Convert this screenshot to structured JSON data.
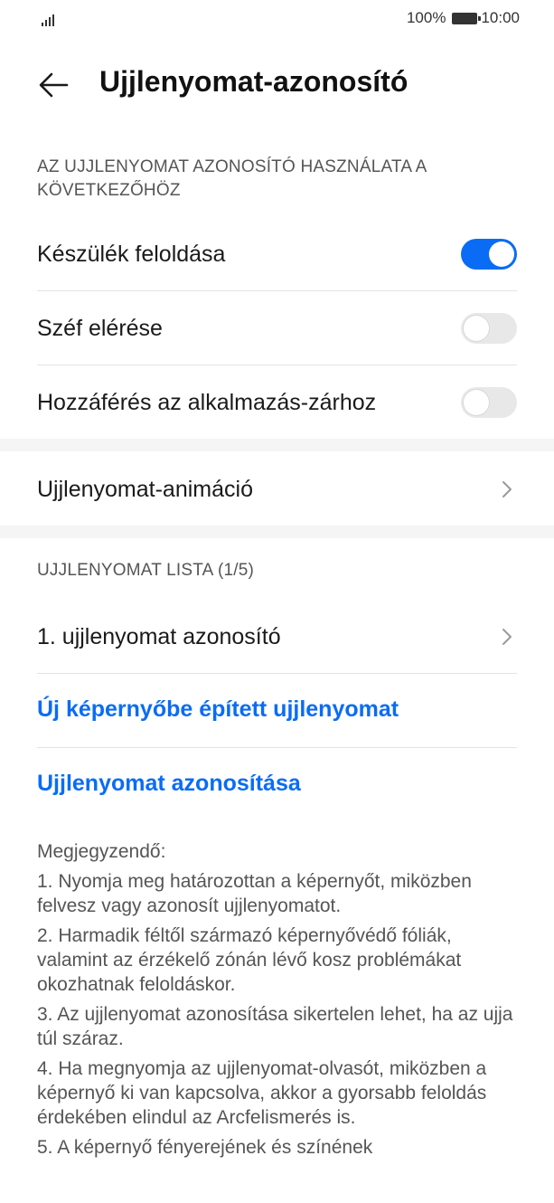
{
  "status": {
    "battery": "100%",
    "time": "10:00"
  },
  "header": {
    "title": "Ujjlenyomat-azonosító"
  },
  "section_use": {
    "label": "AZ UJJLENYOMAT AZONOSÍTÓ HASZNÁLATA A KÖVETKEZŐHÖZ"
  },
  "settings": [
    {
      "label": "Készülék feloldása",
      "enabled": true
    },
    {
      "label": "Széf elérése",
      "enabled": false
    },
    {
      "label": "Hozzáférés az alkalmazás-zárhoz",
      "enabled": false
    }
  ],
  "animation": {
    "label": "Ujjlenyomat-animáció"
  },
  "list_section": {
    "label": "UJJLENYOMAT LISTA (1/5)"
  },
  "fingerprints": [
    {
      "label": "1. ujjlenyomat azonosító"
    }
  ],
  "actions": {
    "new_fingerprint": "Új képernyőbe épített ujjlenyomat",
    "identify": "Ujjlenyomat azonosítása"
  },
  "notes": {
    "title": "Megjegyzendő:",
    "items": [
      "1. Nyomja meg határozottan a képernyőt, miközben felvesz vagy azonosít ujjlenyomatot.",
      "2. Harmadik féltől származó képernyővédő fóliák, valamint az érzékelő zónán lévő kosz problémákat okozhatnak feloldáskor.",
      "3. Az ujjlenyomat azonosítása sikertelen lehet, ha az ujja túl száraz.",
      "4. Ha megnyomja az ujjlenyomat-olvasót, miközben a képernyő ki van kapcsolva, akkor a gyorsabb feloldás érdekében elindul az Arcfelismerés is.",
      "5. A képernyő fényerejének és színének"
    ]
  },
  "colors": {
    "accent": "#0a6cf5",
    "toggle_off": "#e8e8e8",
    "text": "#1a1a1a",
    "secondary_text": "#555555"
  }
}
